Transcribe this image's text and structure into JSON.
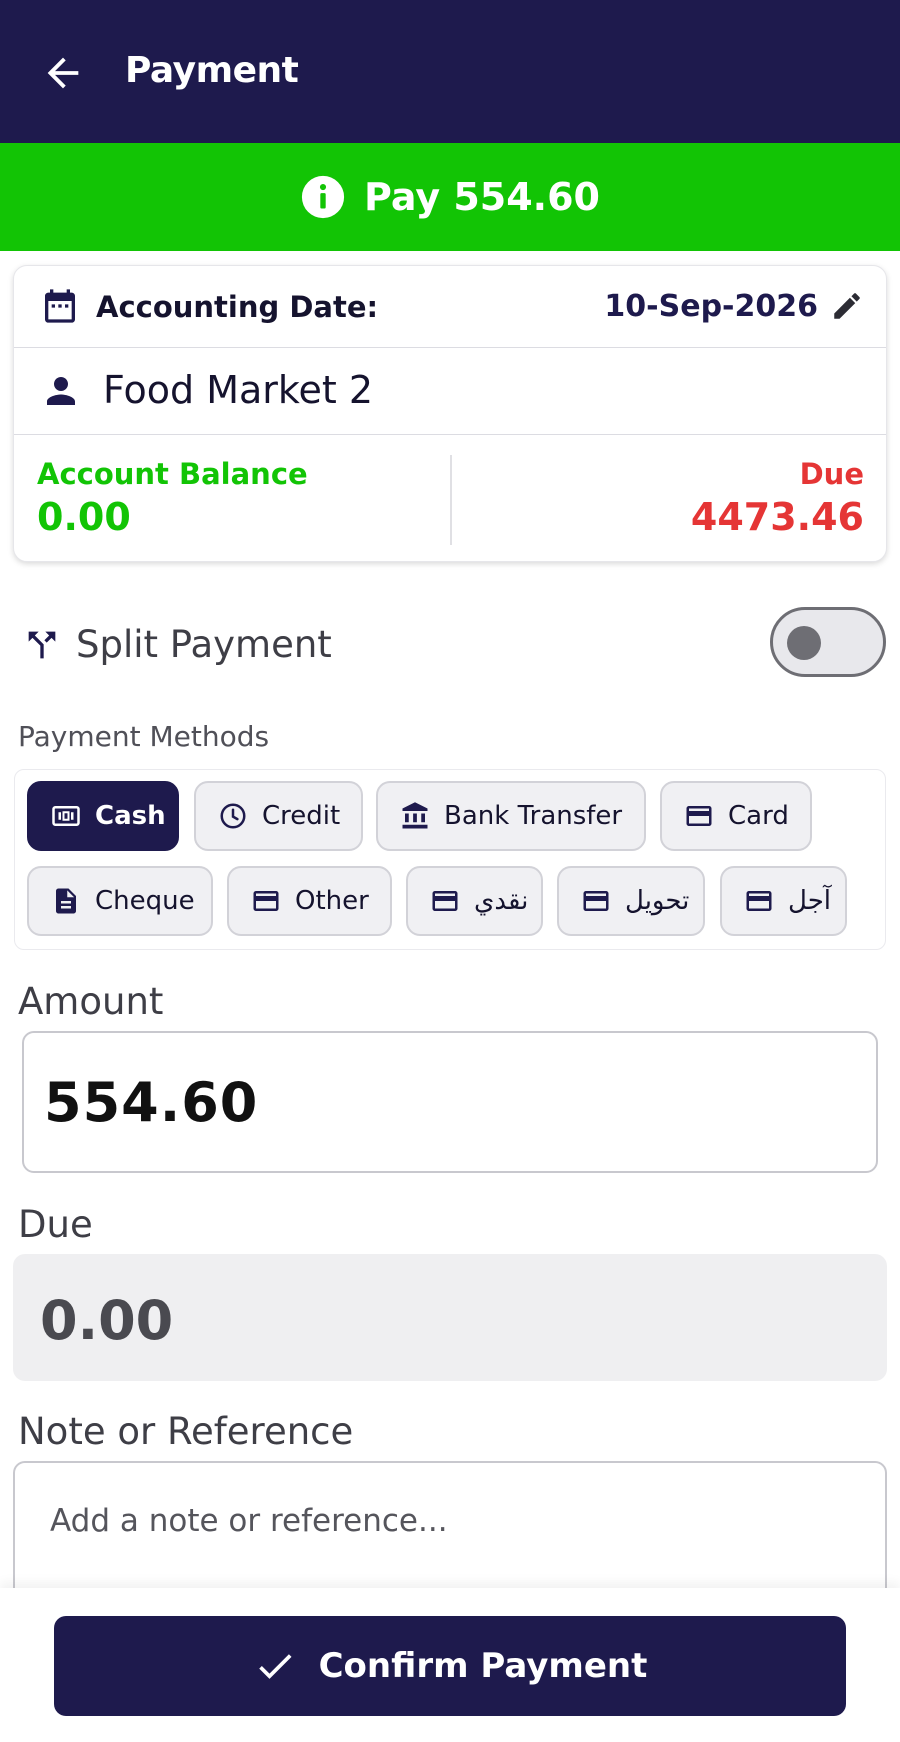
{
  "header": {
    "title": "Payment",
    "back_icon": "arrow-left-icon"
  },
  "banner": {
    "text": "Pay 554.60",
    "icon": "info-icon",
    "color": "#12c405"
  },
  "summary": {
    "date_label": "Accounting Date:",
    "date_value": "10-Sep-2026",
    "customer": "Food Market 2",
    "balance_label": "Account Balance",
    "balance_value": "0.00",
    "due_label": "Due",
    "due_value": "4473.46"
  },
  "split": {
    "label": "Split Payment",
    "enabled": false
  },
  "payment_methods": {
    "label": "Payment Methods",
    "selected": "Cash",
    "options": [
      "Cash",
      "Credit",
      "Bank Transfer",
      "Card",
      "Cheque",
      "Other",
      "نقدي",
      "تحويل",
      "آجل"
    ]
  },
  "amount": {
    "label": "Amount",
    "value": "554.60"
  },
  "due": {
    "label": "Due",
    "value": "0.00"
  },
  "note": {
    "label": "Note or Reference",
    "placeholder": "Add a note or reference..."
  },
  "confirm": {
    "label": "Confirm Payment"
  },
  "colors": {
    "primary": "#1e1a4d",
    "success": "#12c405",
    "danger": "#e53535"
  }
}
